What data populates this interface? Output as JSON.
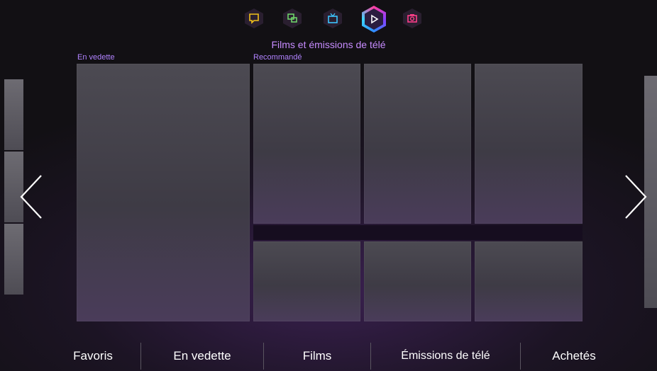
{
  "header": {
    "title": "Films et émissions de télé",
    "icons": [
      {
        "name": "chat-bubble-icon",
        "color": "#f2c21a"
      },
      {
        "name": "multiscreen-icon",
        "color": "#6fd36a"
      },
      {
        "name": "tv-icon",
        "color": "#3cc6ff"
      },
      {
        "name": "play-icon",
        "color": "#ffffff",
        "active": true
      },
      {
        "name": "camera-icon",
        "color": "#ff3f8a"
      }
    ]
  },
  "sections": {
    "featured_label": "En vedette",
    "recommended_label": "Recommandé"
  },
  "bottom_nav": {
    "items": [
      "Favoris",
      "En vedette",
      "Films",
      "Émissions de télé",
      "Achetés"
    ]
  },
  "colors": {
    "accent": "#c78cff",
    "background": "#1c1424"
  }
}
